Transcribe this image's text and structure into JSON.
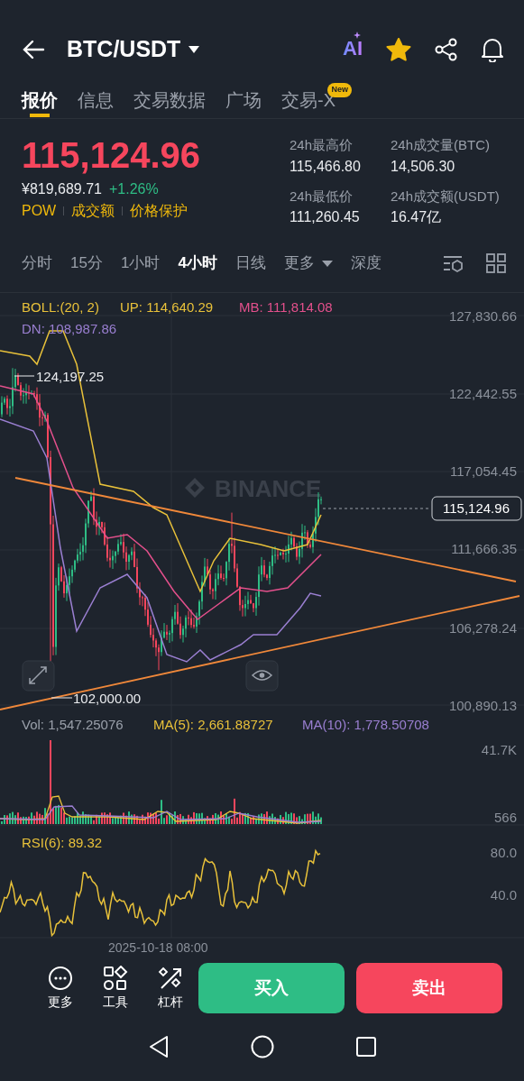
{
  "header": {
    "title": "BTC/USDT",
    "ai_label": "AI",
    "favorite": true
  },
  "tabs": [
    {
      "label": "报价",
      "selected": true
    },
    {
      "label": "信息",
      "selected": false
    },
    {
      "label": "交易数据",
      "selected": false
    },
    {
      "label": "广场",
      "selected": false
    },
    {
      "label": "交易-X",
      "selected": false,
      "badge": "New"
    }
  ],
  "quote": {
    "price": "115,124.96",
    "fiat": "¥819,689.71",
    "change": "+1.26%",
    "tags": [
      "POW",
      "成交额",
      "价格保护"
    ]
  },
  "stats": [
    {
      "label": "24h最高价",
      "value": "115,466.80"
    },
    {
      "label": "24h成交量(BTC)",
      "value": "14,506.30"
    },
    {
      "label": "24h最低价",
      "value": "111,260.45"
    },
    {
      "label": "24h成交额(USDT)",
      "value": "16.47亿"
    }
  ],
  "intervals": [
    {
      "label": "分时",
      "selected": false
    },
    {
      "label": "15分",
      "selected": false
    },
    {
      "label": "1小时",
      "selected": false
    },
    {
      "label": "4小时",
      "selected": true
    },
    {
      "label": "日线",
      "selected": false
    },
    {
      "label": "更多",
      "selected": false,
      "dropdown": true
    },
    {
      "label": "深度",
      "selected": false
    }
  ],
  "main_chart": {
    "indicators": [
      {
        "text": "BOLL:(20, 2)",
        "color": "#e8c13a"
      },
      {
        "text": "UP: 114,640.29",
        "color": "#e8c13a"
      },
      {
        "text": "MB: 111,814.08",
        "color": "#e4508c"
      },
      {
        "text": "DN: 108,987.86",
        "color": "#9a7fd1"
      }
    ],
    "price_axis": [
      "127,830.66",
      "122,442.55",
      "117,054.45",
      "111,666.35",
      "106,278.24",
      "100,890.13"
    ],
    "high_marker": "124,197.25",
    "low_marker": "102,000.00",
    "last_price": "115,124.96",
    "watermark": "BINANCE"
  },
  "volume": {
    "indicators": [
      {
        "text": "Vol: 1,547.25076",
        "color": "#9aa0aa"
      },
      {
        "text": "MA(5): 2,661.88727",
        "color": "#e8c13a"
      },
      {
        "text": "MA(10): 1,778.50708",
        "color": "#9a7fd1"
      }
    ],
    "axis": [
      "41.7K",
      "566"
    ]
  },
  "rsi": {
    "label": "RSI(6): 89.32",
    "axis": [
      "80.0",
      "40.0"
    ]
  },
  "time_label": "2025-10-18 08:00",
  "actions": [
    {
      "label": "更多",
      "kind": "more"
    },
    {
      "label": "工具",
      "kind": "tools"
    },
    {
      "label": "杠杆",
      "kind": "leverage"
    }
  ],
  "trade_buttons": [
    {
      "label": "买入",
      "kind": "buy"
    },
    {
      "label": "卖出",
      "kind": "sell"
    }
  ]
}
